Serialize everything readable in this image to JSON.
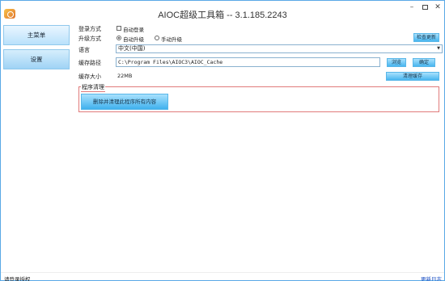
{
  "window": {
    "title": "AIOC超级工具箱 -- 3.1.185.2243",
    "minimize_glyph": "–",
    "close_glyph": "✕"
  },
  "sidebar": {
    "items": [
      {
        "label": "主菜单"
      },
      {
        "label": "设置"
      }
    ]
  },
  "settings": {
    "login_mode": {
      "label": "登录方式",
      "auto_login_label": "自动登录",
      "auto_login_checked": false
    },
    "upgrade_mode": {
      "label": "升级方式",
      "auto_label": "自动升级",
      "manual_label": "手动升级",
      "selected": "auto"
    },
    "check_update_button": "检查更新",
    "language": {
      "label": "语言",
      "value": "中文(中国)",
      "arrow": "▼"
    },
    "cache_path": {
      "label": "缓存路径",
      "value": "C:\\Program Files\\AIOC3\\AIOC_Cache"
    },
    "browse_button": "浏览",
    "confirm_button": "确定",
    "cache_size": {
      "label": "缓存大小",
      "value": "22MB"
    },
    "clear_cache_button": "清理缓存",
    "program_cleanup": {
      "title": "程序清理",
      "button": "删除并清理此程序所有内容"
    }
  },
  "statusbar": {
    "left": "请登录授权",
    "right": "更新日志"
  },
  "colors": {
    "window_border": "#5aa9e6",
    "button_blue": "#48b6ef",
    "group_border": "#e07b7b",
    "link": "#1a4fc4"
  }
}
